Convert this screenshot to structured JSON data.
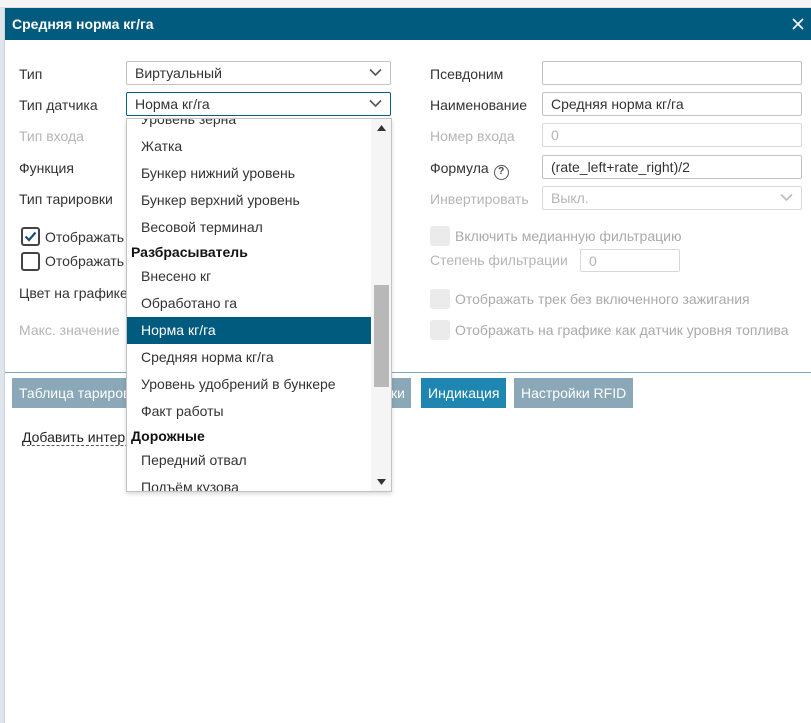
{
  "dialog": {
    "title": "Средняя норма кг/га"
  },
  "left_form": {
    "type_label": "Тип",
    "type_value": "Виртуальный",
    "sensor_type_label": "Тип датчика",
    "sensor_type_value": "Норма кг/га",
    "input_type_label": "Тип входа",
    "function_label": "Функция",
    "calibration_type_label": "Тип тарировки",
    "show_checkbox_1_label": "Отображать",
    "show_checkbox_1_checked": true,
    "show_checkbox_2_label": "Отображать",
    "show_checkbox_2_checked": false,
    "chart_color_label": "Цвет на графике",
    "max_value_label": "Макс. значение"
  },
  "right_form": {
    "alias_label": "Псевдоним",
    "alias_value": "",
    "name_label": "Наименование",
    "name_value": "Средняя норма кг/га",
    "input_number_label": "Номер входа",
    "input_number_value": "0",
    "formula_label": "Формула",
    "formula_value": "(rate_left+rate_right)/2",
    "invert_label": "Инвертировать",
    "invert_value": "Выкл.",
    "median_filter_label": "Включить медианную фильтрацию",
    "filter_degree_label": "Степень фильтрации",
    "filter_degree_value": "0",
    "track_without_ignition_label": "Отображать трек без включенного зажигания",
    "fuel_level_chart_label": "Отображать на графике как датчик уровня топлива"
  },
  "tabs": [
    {
      "label": "Таблица тарировки",
      "active": false
    },
    {
      "label": "ки",
      "active": false
    },
    {
      "label": "Индикация",
      "active": true
    },
    {
      "label": "Настройки RFID",
      "active": false
    }
  ],
  "add_interval_link": "Добавить интервал",
  "dropdown": {
    "items": [
      {
        "kind": "item",
        "label": "Уровень зерна"
      },
      {
        "kind": "item",
        "label": "Жатка"
      },
      {
        "kind": "item",
        "label": "Бункер нижний уровень"
      },
      {
        "kind": "item",
        "label": "Бункер верхний уровень"
      },
      {
        "kind": "item",
        "label": "Весовой терминал"
      },
      {
        "kind": "group",
        "label": "Разбрасыватель"
      },
      {
        "kind": "item",
        "label": "Внесено кг"
      },
      {
        "kind": "item",
        "label": "Обработано га"
      },
      {
        "kind": "item",
        "label": "Норма кг/га",
        "selected": true
      },
      {
        "kind": "item",
        "label": "Средняя норма кг/га"
      },
      {
        "kind": "item",
        "label": "Уровень удобрений в бункере"
      },
      {
        "kind": "item",
        "label": "Факт работы"
      },
      {
        "kind": "group",
        "label": "Дорожные"
      },
      {
        "kind": "item",
        "label": "Передний отвал"
      },
      {
        "kind": "item",
        "label": "Подъём кузова"
      }
    ]
  },
  "icons": {
    "close": "close-icon",
    "chevron": "chevron-down-icon",
    "help": "help-icon",
    "check": "checkmark-icon"
  },
  "colors": {
    "titlebar": "#005b7f",
    "selected_item": "#005b7f",
    "active_tab": "#1f86b1",
    "inactive_tab": "#8aa8b8"
  }
}
